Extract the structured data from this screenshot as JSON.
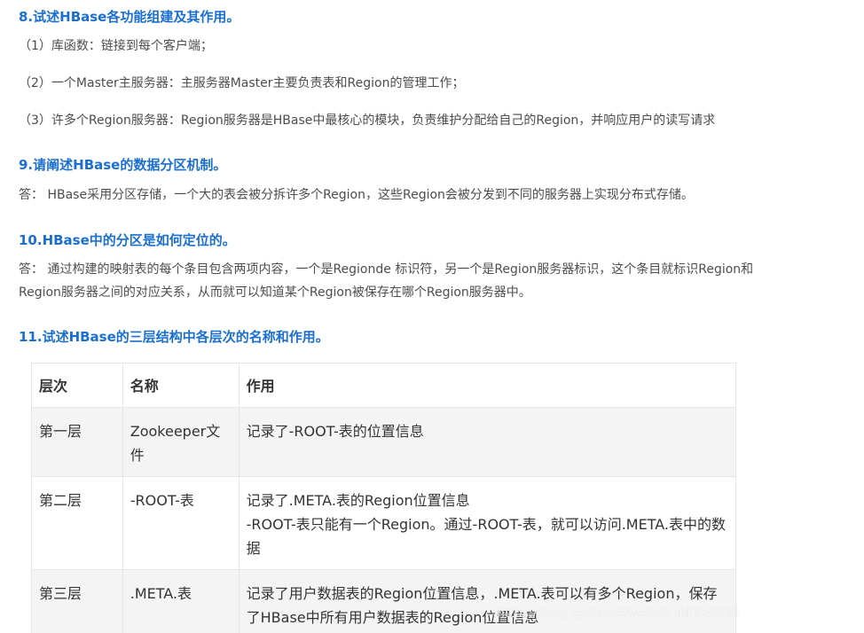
{
  "sections": {
    "q8": {
      "title": "8.试述HBase各功能组建及其作用。",
      "items": [
        "（1）库函数：链接到每个客户端；",
        "（2）一个Master主服务器：主服务器Master主要负责表和Region的管理工作；",
        "（3）许多个Region服务器：Region服务器是HBase中最核心的模块，负责维护分配给自己的Region，并响应用户的读写请求"
      ]
    },
    "q9": {
      "title": "9.请阐述HBase的数据分区机制。",
      "answer": "答：  HBase采用分区存储，一个大的表会被分拆许多个Region，这些Region会被分发到不同的服务器上实现分布式存储。"
    },
    "q10": {
      "title": "10.HBase中的分区是如何定位的。",
      "answer_line1": "答：  通过构建的映射表的每个条目包含两项内容，一个是Regionde 标识符，另一个是Region服务器标识，这个条目就标识Region和",
      "answer_line2": "Region服务器之间的对应关系，从而就可以知道某个Region被保存在哪个Region服务器中。"
    },
    "q11": {
      "title": "11.试述HBase的三层结构中各层次的名称和作用。",
      "table": {
        "headers": [
          "层次",
          "名称",
          "作用"
        ],
        "rows": [
          {
            "level": "第一层",
            "name": "Zookeeper文件",
            "role_lines": [
              "记录了-ROOT-表的位置信息"
            ]
          },
          {
            "level": "第二层",
            "name": "-ROOT-表",
            "role_lines": [
              "记录了.META.表的Region位置信息",
              "-ROOT-表只能有一个Region。通过-ROOT-表，就可以访问.META.表中的数据"
            ]
          },
          {
            "level": "第三层",
            "name": ".META.表",
            "role_lines": [
              "记录了用户数据表的Region位置信息，.META.表可以有多个Region，保存了HBase中所有用户数据表的Region位置信息"
            ]
          }
        ]
      }
    }
  },
  "watermark": "https://blog.csdn.net/weixin_44318830"
}
